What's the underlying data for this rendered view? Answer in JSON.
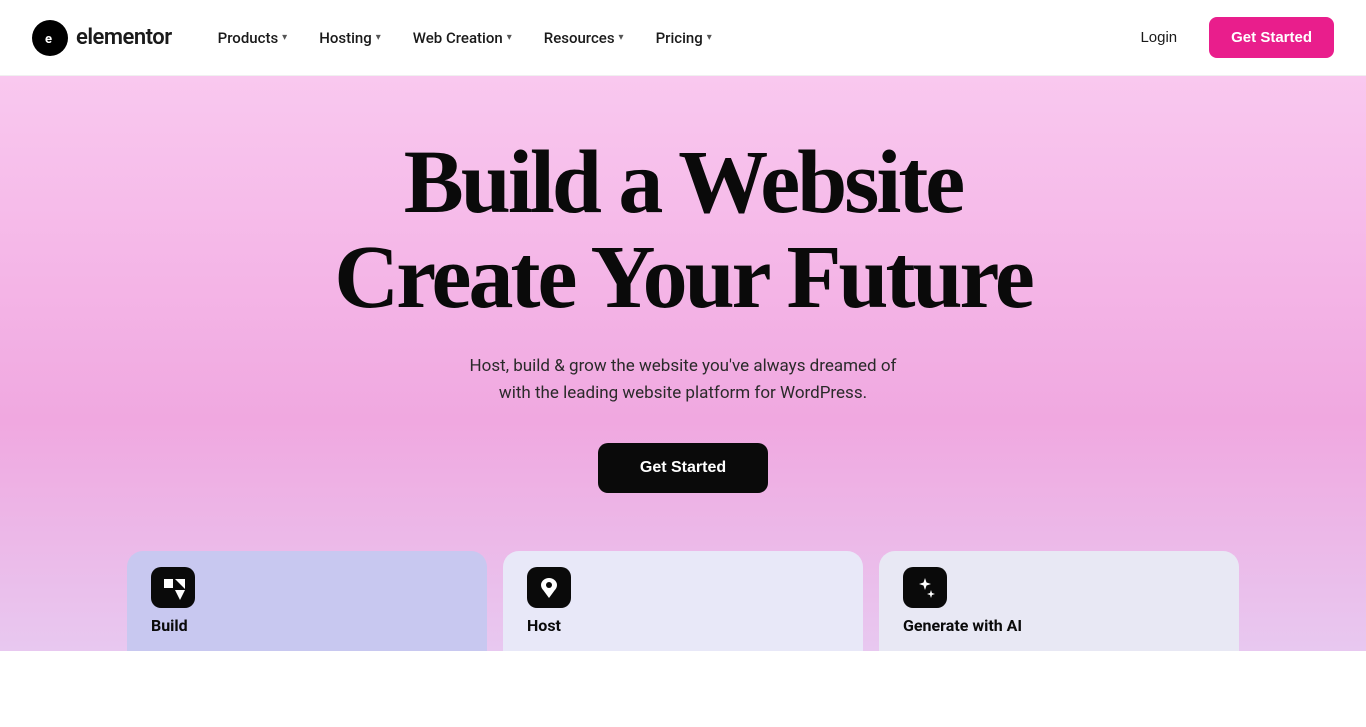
{
  "brand": {
    "logo_symbol": "e",
    "logo_name": "elementor"
  },
  "nav": {
    "items": [
      {
        "id": "products",
        "label": "Products",
        "has_dropdown": true
      },
      {
        "id": "hosting",
        "label": "Hosting",
        "has_dropdown": true
      },
      {
        "id": "web-creation",
        "label": "Web Creation",
        "has_dropdown": true
      },
      {
        "id": "resources",
        "label": "Resources",
        "has_dropdown": true
      },
      {
        "id": "pricing",
        "label": "Pricing",
        "has_dropdown": true
      }
    ]
  },
  "header": {
    "login_label": "Login",
    "get_started_label": "Get Started"
  },
  "hero": {
    "title_line1": "Build a Website",
    "title_line2": "Create Your Future",
    "subtitle": "Host, build & grow the website you've always dreamed of\nwith the leading website platform for WordPress.",
    "cta_label": "Get Started"
  },
  "cards": [
    {
      "id": "build",
      "label": "Build",
      "icon": "⚡",
      "bg_color": "#c8c8f0"
    },
    {
      "id": "host",
      "label": "Host",
      "icon": "☁",
      "bg_color": "#e4e4f8"
    },
    {
      "id": "ai",
      "label": "Generate with AI",
      "icon": "✦",
      "bg_color": "#eaeaf6"
    }
  ],
  "colors": {
    "accent_pink": "#e91e8c",
    "hero_gradient_start": "#f9c8ef",
    "hero_gradient_end": "#e8c8f0",
    "cta_dark": "#0a0a0a"
  }
}
